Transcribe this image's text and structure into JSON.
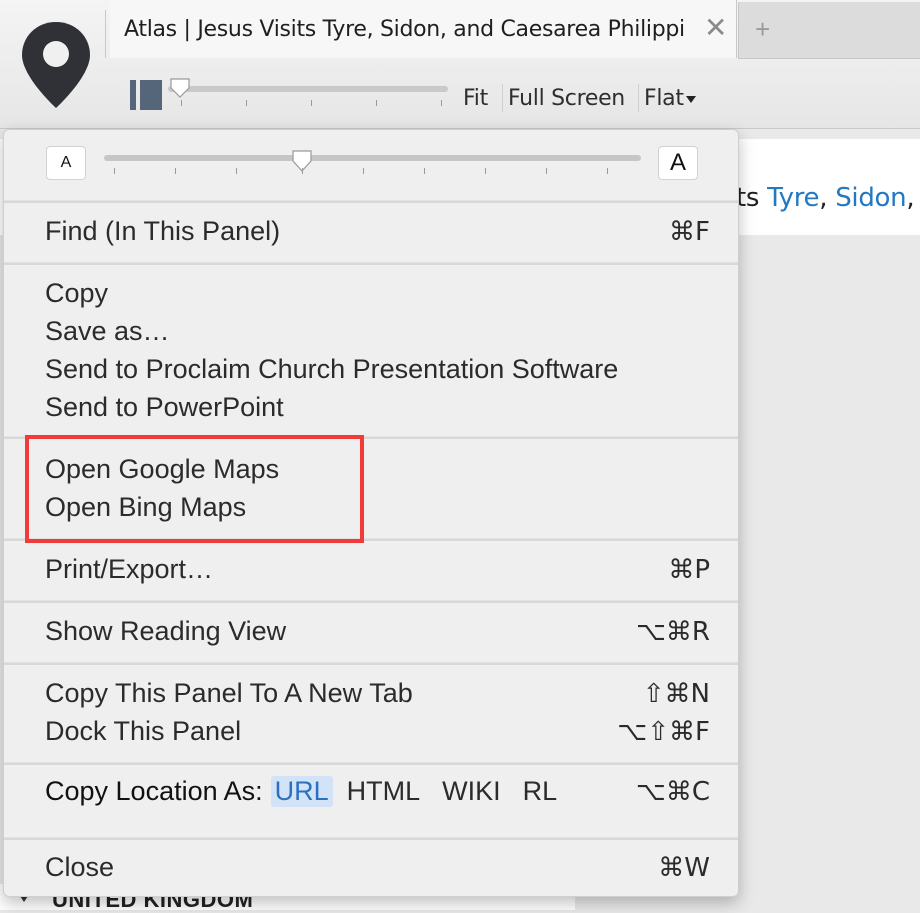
{
  "window": {
    "tab_title": "Atlas | Jesus Visits Tyre, Sidon, and Caesarea Philippi",
    "close_glyph": "✕",
    "new_tab_glyph": "+"
  },
  "toolbar": {
    "fit_label": "Fit",
    "fullscreen_label": "Full Screen",
    "view_label": "Flat"
  },
  "background": {
    "text_prefix": "ts ",
    "link1": "Tyre",
    "sep1": ", ",
    "link2": "Sidon",
    "sep2": ",",
    "bottom_label": "UNITED KINGDOM"
  },
  "menu": {
    "font_small_label": "A",
    "font_large_label": "A",
    "find": {
      "label": "Find (In This Panel)",
      "shortcut": "⌘F"
    },
    "copy": "Copy",
    "save_as": "Save as…",
    "send_proclaim": "Send to Proclaim Church Presentation Software",
    "send_powerpoint": "Send to PowerPoint",
    "open_google": "Open Google Maps",
    "open_bing": "Open Bing Maps",
    "print": {
      "label": "Print/Export…",
      "shortcut": "⌘P"
    },
    "reading": {
      "label": "Show Reading View",
      "shortcut": "⌥⌘R"
    },
    "copy_panel": {
      "label": "Copy This Panel To A New Tab",
      "shortcut": "⇧⌘N"
    },
    "dock": {
      "label": "Dock This Panel",
      "shortcut": "⌥⇧⌘F"
    },
    "copy_location": {
      "label": "Copy Location As:",
      "formats": [
        "URL",
        "HTML",
        "WIKI",
        "RL"
      ],
      "selected": "URL",
      "shortcut": "⌥⌘C"
    },
    "close": {
      "label": "Close",
      "shortcut": "⌘W"
    }
  },
  "colors": {
    "link": "#2378c2",
    "highlight_box": "#f23a3a",
    "selected_format_bg": "#d2e3f7"
  },
  "icons": [
    "map-pin-icon",
    "chevron-down-icon",
    "close-icon",
    "plus-icon",
    "panel-toggle-icon",
    "slider-thumb-icon"
  ]
}
